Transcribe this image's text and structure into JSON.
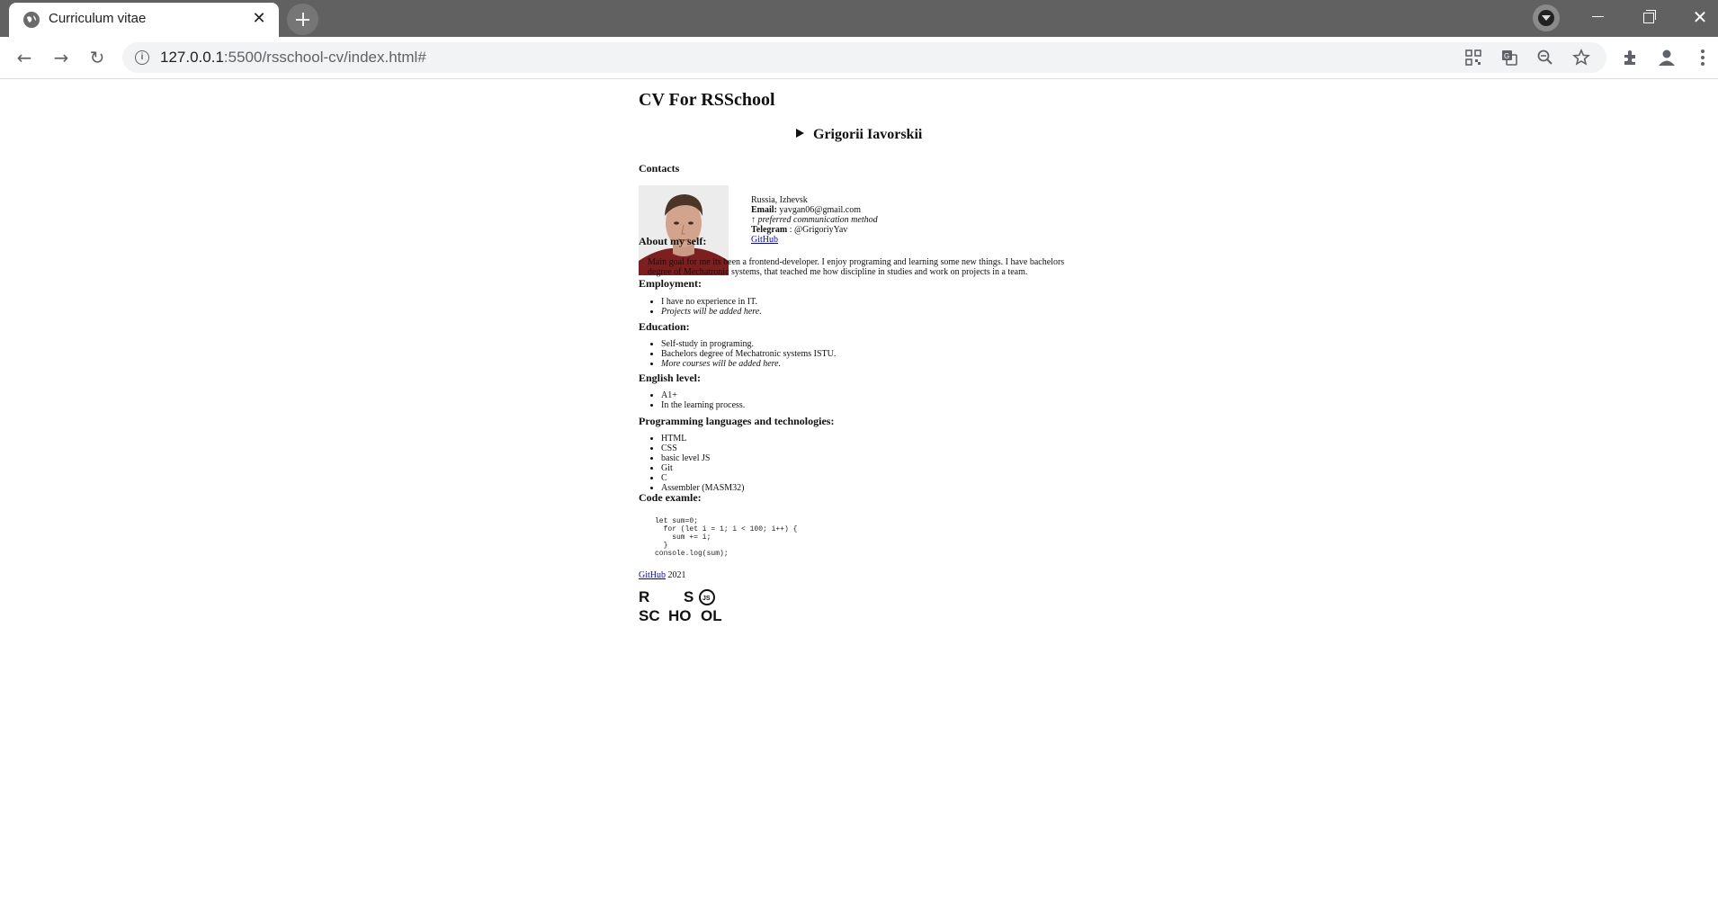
{
  "browser": {
    "tab_title": "Curriculum vitae",
    "tab_close": "✕",
    "url_host": "127.0.0.1",
    "url_rest": ":5500/rsschool-cv/index.html#",
    "nav_back": "←",
    "nav_forward": "→",
    "nav_reload": "↻",
    "win_close": "✕"
  },
  "page": {
    "title": "CV For RSSchool",
    "name": "Grigorii Iavorskii",
    "contacts_heading": "Contacts",
    "location": "Russia, Izhevsk",
    "email_label": "Email:",
    "email": "yavgan06@gmail.com",
    "email_note": "↑ preferred communication method",
    "telegram_label": "Telegram",
    "telegram": " : @GrigoriyYav",
    "github_link": "GitHub",
    "about_heading": "About my self:",
    "about_text": "Main goal for me its been a frontend-developer. I enjoy programing and learning some new things. I have bachelors degree of Mechatronic systems, that teached me how discipline in studies and work on projects in a team.",
    "employment_heading": "Employment:",
    "employment": [
      "I have no experience in IT.",
      "Projects will be added here."
    ],
    "education_heading": "Education:",
    "education": [
      "Self-study in programing.",
      "Bachelors degree of Mechatronic systems ISTU.",
      "More courses will be added here."
    ],
    "english_heading": "English level:",
    "english": [
      "A1+",
      "In the learning process."
    ],
    "tech_heading": "Programming languages and technologies:",
    "tech": [
      "HTML",
      "CSS",
      "basic level JS",
      "Git",
      "C",
      "Assembler (MASM32)"
    ],
    "code_heading": "Code examle:",
    "code": "let sum=0;\n  for (let i = 1; i < 100; i++) {\n    sum += i;\n  }\nconsole.log(sum);",
    "footer_link": "GitHub",
    "footer_year": " 2021",
    "logo_text": [
      "R",
      "S",
      "SC",
      "HO",
      "OL",
      "JS"
    ]
  }
}
